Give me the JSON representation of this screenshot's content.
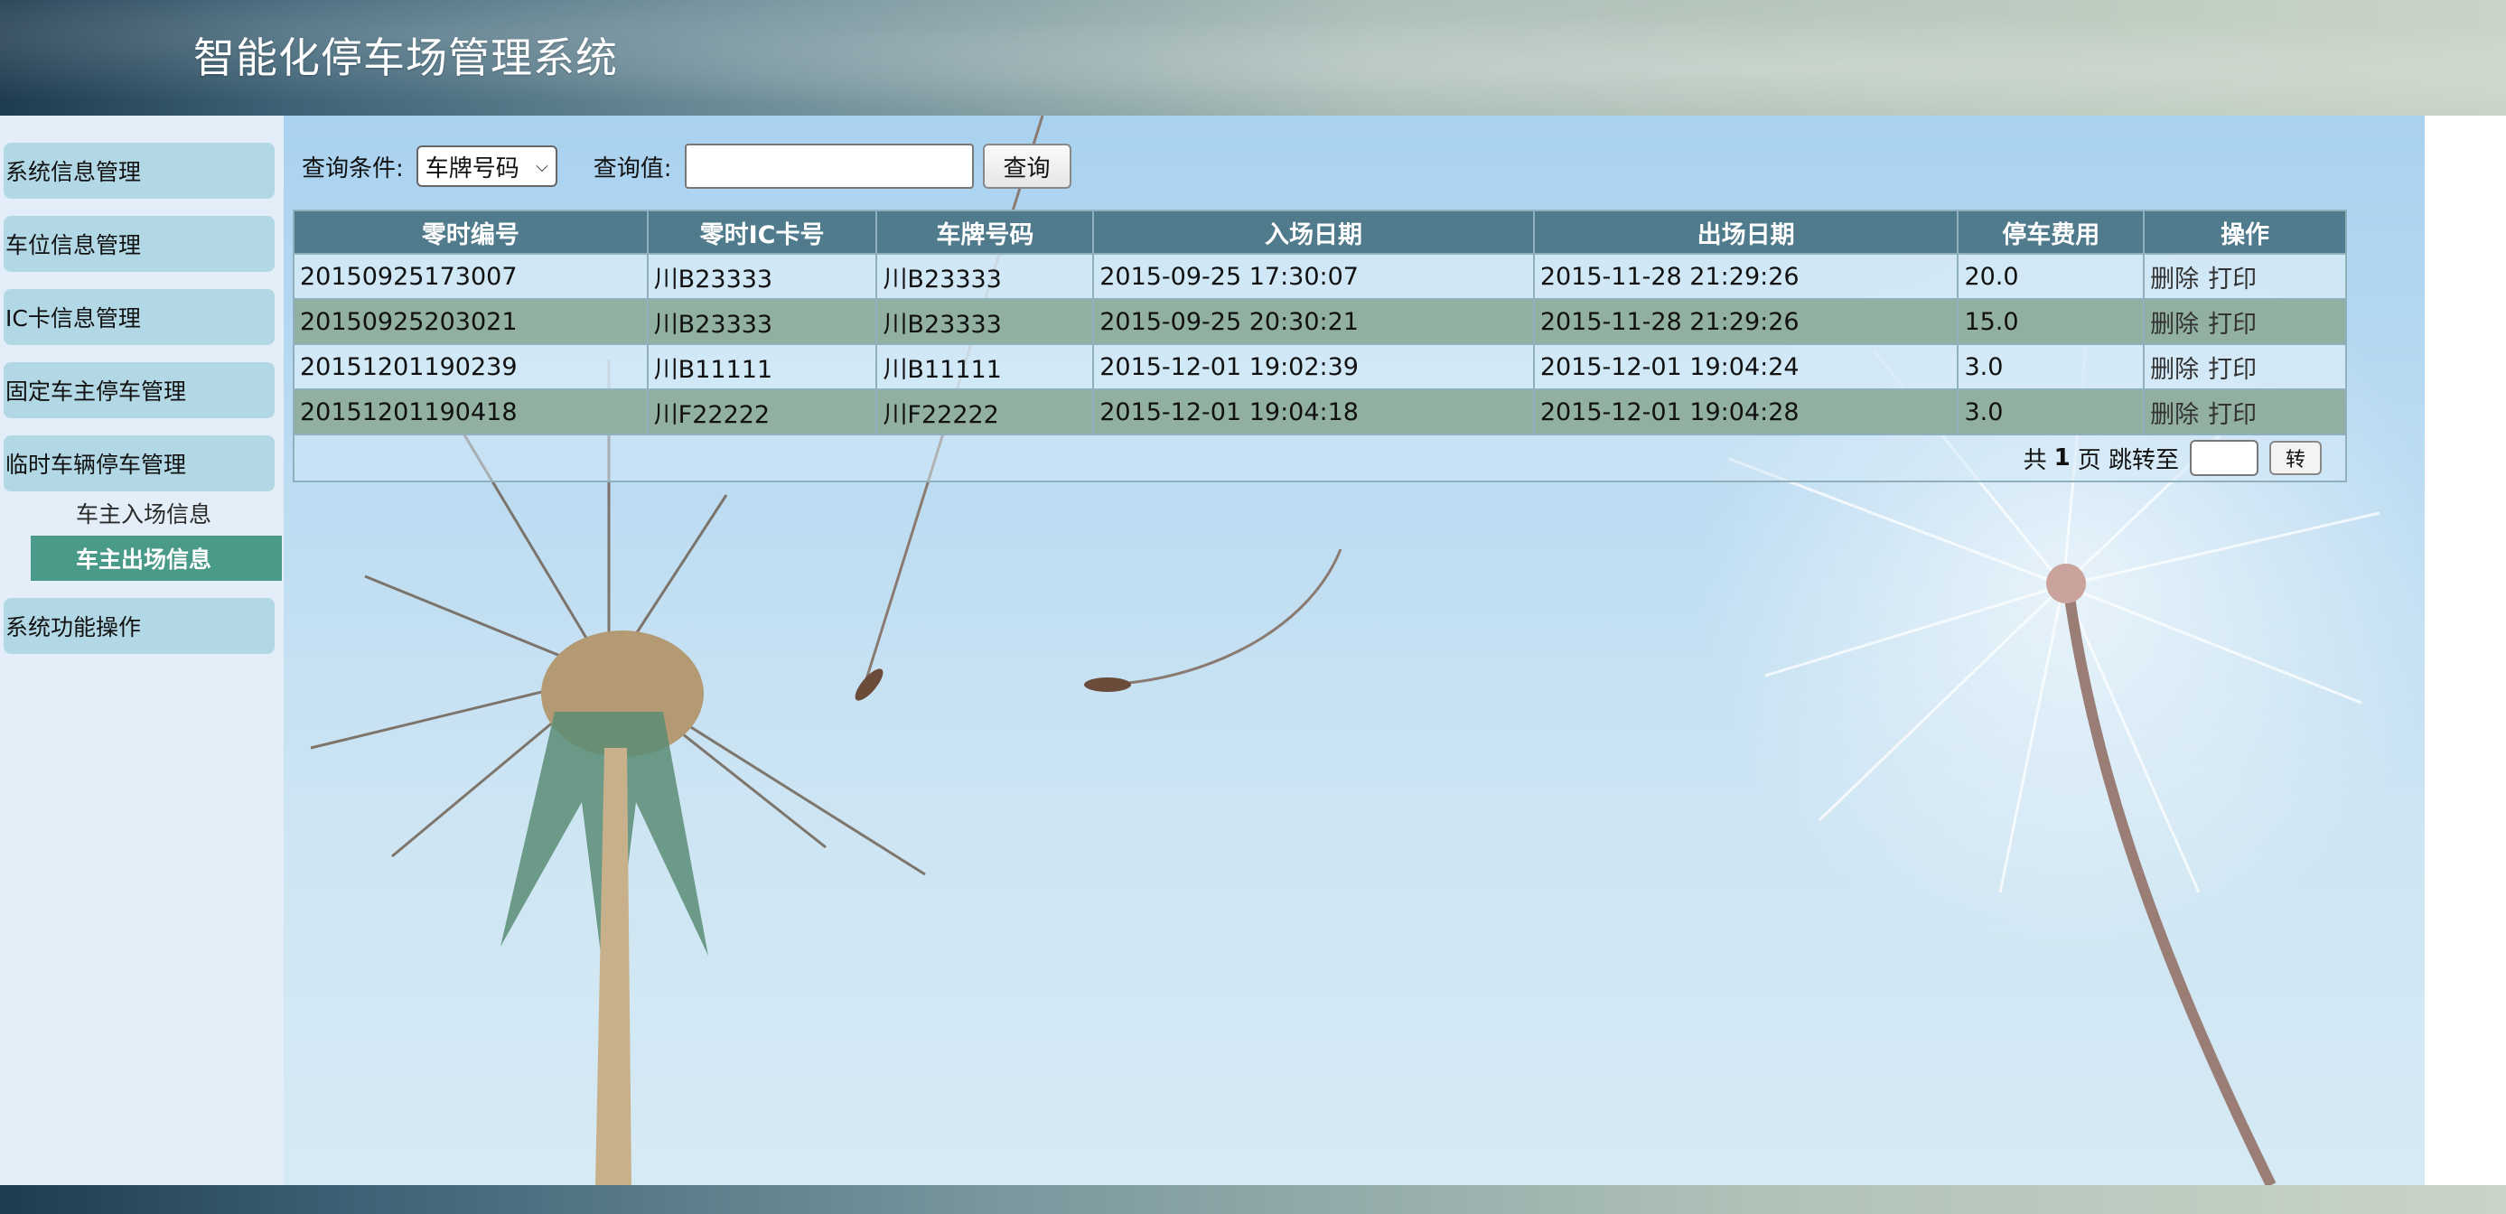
{
  "header": {
    "title": "智能化停车场管理系统"
  },
  "sidebar": {
    "groups": [
      {
        "label": "系统信息管理"
      },
      {
        "label": "车位信息管理"
      },
      {
        "label": "IC卡信息管理"
      },
      {
        "label": "固定车主停车管理"
      },
      {
        "label": "临时车辆停车管理"
      },
      {
        "label": "系统功能操作"
      }
    ],
    "subitems": [
      {
        "label": "车主入场信息"
      },
      {
        "label": "车主出场信息"
      }
    ]
  },
  "query": {
    "condition_label": "查询条件:",
    "condition_selected": "车牌号码",
    "value_label": "查询值:",
    "value": "",
    "button": "查询"
  },
  "table": {
    "headers": [
      "零时编号",
      "零时IC卡号",
      "车牌号码",
      "入场日期",
      "出场日期",
      "停车费用",
      "操作"
    ],
    "rows": [
      {
        "id": "20150925173007",
        "ic": "川B23333",
        "plate": "川B23333",
        "in": "2015-09-25 17:30:07",
        "out": "2015-11-28 21:29:26",
        "fee": "20.0"
      },
      {
        "id": "20150925203021",
        "ic": "川B23333",
        "plate": "川B23333",
        "in": "2015-09-25 20:30:21",
        "out": "2015-11-28 21:29:26",
        "fee": "15.0"
      },
      {
        "id": "20151201190239",
        "ic": "川B11111",
        "plate": "川B11111",
        "in": "2015-12-01 19:02:39",
        "out": "2015-12-01 19:04:24",
        "fee": "3.0"
      },
      {
        "id": "20151201190418",
        "ic": "川F22222",
        "plate": "川F22222",
        "in": "2015-12-01 19:04:18",
        "out": "2015-12-01 19:04:28",
        "fee": "3.0"
      }
    ],
    "actions": {
      "delete": "删除",
      "print": "打印"
    }
  },
  "pager": {
    "prefix": "共",
    "pages": "1",
    "suffix": "页 跳转至",
    "button": "转"
  },
  "colors": {
    "header_bg": "#4f7b8c",
    "row_alt": "#91b0a2",
    "active_nav": "#4a9a8a",
    "nav_group": "#b3d8e5"
  }
}
